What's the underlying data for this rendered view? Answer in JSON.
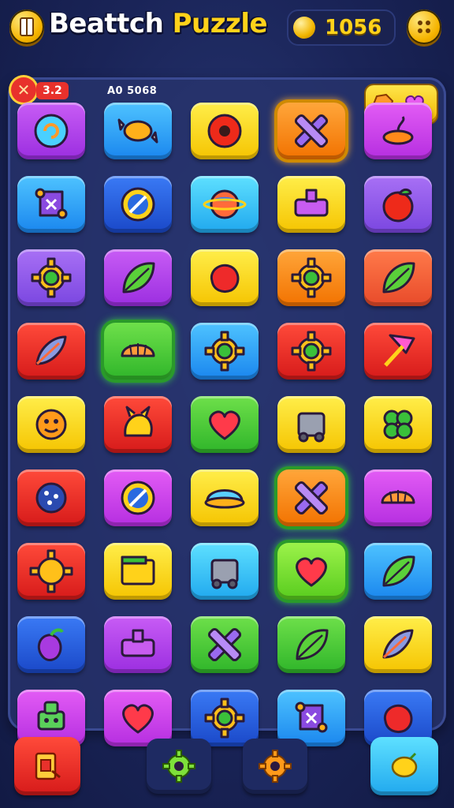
{
  "header": {
    "title_part1": "Beattch",
    "title_part2": " Puzzle",
    "score": "1056",
    "left_icon": "book-icon",
    "right_icon": "menu-dots-icon"
  },
  "status": {
    "level_badge": "3.2",
    "code_text": "A0 5068"
  },
  "board": {
    "rows": [
      [
        {
          "color": "purple",
          "icon": "swirl"
        },
        {
          "color": "blue",
          "icon": "candy"
        },
        {
          "color": "yellow",
          "icon": "ring"
        },
        {
          "color": "orange",
          "icon": "cross",
          "highlight": "orange"
        },
        {
          "color": "magenta",
          "icon": "lamp"
        }
      ],
      [
        {
          "color": "blue",
          "icon": "puzzle-star"
        },
        {
          "color": "dblue",
          "icon": "compass"
        },
        {
          "color": "cyan",
          "icon": "planet"
        },
        {
          "color": "yellow",
          "icon": "box"
        },
        {
          "color": "violet",
          "icon": "apple"
        }
      ],
      [
        {
          "color": "violet",
          "icon": "gear"
        },
        {
          "color": "purple",
          "icon": "leaf"
        },
        {
          "color": "yellow",
          "icon": "blob"
        },
        {
          "color": "orange",
          "icon": "gear"
        },
        {
          "color": "salmon",
          "icon": "leaf"
        }
      ],
      [
        {
          "color": "red",
          "icon": "feather"
        },
        {
          "color": "green",
          "icon": "shell",
          "highlight": "green"
        },
        {
          "color": "blue",
          "icon": "gear"
        },
        {
          "color": "red",
          "icon": "gear"
        },
        {
          "color": "red",
          "icon": "shovel"
        }
      ],
      [
        {
          "color": "yellow",
          "icon": "face"
        },
        {
          "color": "red",
          "icon": "creature"
        },
        {
          "color": "green",
          "icon": "heart"
        },
        {
          "color": "yellow",
          "icon": "machine"
        },
        {
          "color": "yellow",
          "icon": "clover"
        }
      ],
      [
        {
          "color": "red",
          "icon": "cookie"
        },
        {
          "color": "magenta",
          "icon": "compass"
        },
        {
          "color": "yellow",
          "icon": "bowl"
        },
        {
          "color": "orange",
          "icon": "cross",
          "highlight": "green"
        },
        {
          "color": "magenta",
          "icon": "shell"
        }
      ],
      [
        {
          "color": "red",
          "icon": "sun"
        },
        {
          "color": "yellow",
          "icon": "folder"
        },
        {
          "color": "cyan",
          "icon": "machine"
        },
        {
          "color": "lime",
          "icon": "heart",
          "highlight": "green"
        },
        {
          "color": "blue",
          "icon": "leaf"
        }
      ],
      [
        {
          "color": "dblue",
          "icon": "fruit"
        },
        {
          "color": "purple",
          "icon": "box"
        },
        {
          "color": "green",
          "icon": "cross"
        },
        {
          "color": "green",
          "icon": "leaf"
        },
        {
          "color": "yellow",
          "icon": "feather"
        }
      ],
      [
        {
          "color": "magenta",
          "icon": "robot"
        },
        {
          "color": "magenta",
          "icon": "heart"
        },
        {
          "color": "dblue",
          "icon": "gear"
        },
        {
          "color": "blue",
          "icon": "puzzle-star"
        },
        {
          "color": "dblue",
          "icon": "blob"
        }
      ]
    ]
  },
  "bottom_bar": {
    "buttons": [
      {
        "name": "exit-button",
        "icon": "exit-icon",
        "color": "red"
      },
      {
        "name": "settings-gear-button",
        "icon": "green-gear-icon",
        "color": "dark"
      },
      {
        "name": "options-gear-button",
        "icon": "orange-gear-icon",
        "color": "dark"
      },
      {
        "name": "hint-button",
        "icon": "lemon-icon",
        "color": "cyan"
      }
    ]
  },
  "colors": {
    "accent_yellow": "#ffd21a",
    "background": "#1a2458",
    "badge_red": "#e8312c"
  }
}
